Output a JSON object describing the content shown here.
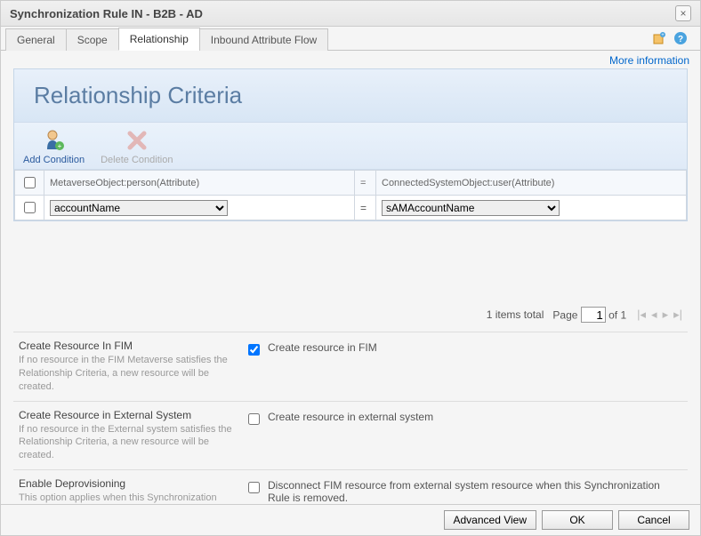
{
  "window": {
    "title": "Synchronization Rule IN - B2B - AD",
    "close_label": "×"
  },
  "tabs": [
    {
      "label": "General"
    },
    {
      "label": "Scope"
    },
    {
      "label": "Relationship"
    },
    {
      "label": "Inbound Attribute Flow"
    }
  ],
  "active_tab_index": 2,
  "more_info": "More information",
  "section_title": "Relationship Criteria",
  "toolbar": {
    "add": "Add Condition",
    "delete": "Delete Condition"
  },
  "criteria_headers": {
    "left": "MetaverseObject:person(Attribute)",
    "right": "ConnectedSystemObject:user(Attribute)",
    "op": "="
  },
  "criteria_row": {
    "left_options": [
      "accountName"
    ],
    "left_selected": "accountName",
    "op": "=",
    "right_options": [
      "sAMAccountName"
    ],
    "right_selected": "sAMAccountName"
  },
  "pager": {
    "total_text": "1 items total",
    "page_label": "Page",
    "page_value": "1",
    "of_text": "of 1"
  },
  "options": {
    "create_fim": {
      "title": "Create Resource In FIM",
      "desc": "If no resource in the FIM Metaverse satisfies the Relationship Criteria, a new resource will be created.",
      "checkbox_label": "Create resource in FIM",
      "checked": true
    },
    "create_ext": {
      "title": "Create Resource in External System",
      "desc": "If no resource in the External system satisfies the Relationship Criteria, a new resource will be created.",
      "checkbox_label": "Create resource in external system",
      "checked": false
    },
    "deprov": {
      "title": "Enable Deprovisioning",
      "desc": "This option applies when this Synchronization Rule is removed from an resource in FIM.",
      "checkbox_label": "Disconnect FIM resource from external system resource when this Synchronization Rule is removed.",
      "checked": false
    }
  },
  "footer": {
    "advanced": "Advanced View",
    "ok": "OK",
    "cancel": "Cancel"
  }
}
